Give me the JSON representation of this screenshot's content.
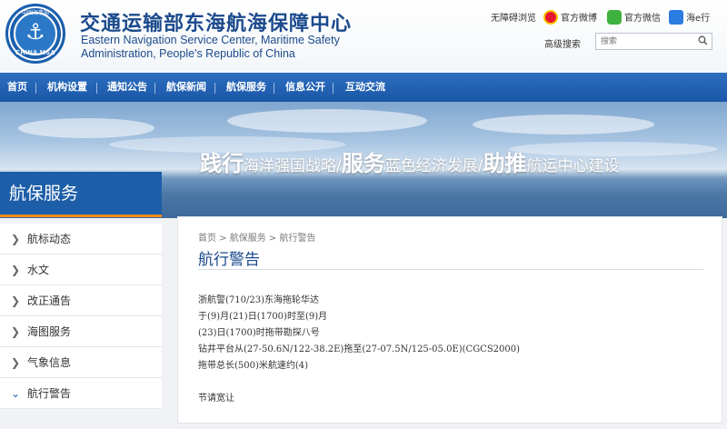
{
  "header": {
    "org_name_cn": "交通运输部东海航海保障中心",
    "org_name_en_line1": "Eastern Navigation Service Center, Maritime Safety",
    "org_name_en_line2": "Administration, People's Republic of China",
    "logo_text": "CHINA MSA",
    "logo_text_top": "中国海事局",
    "links": {
      "accessibility": "无障碍浏览",
      "weibo": "官方微博",
      "wechat": "官方微信",
      "app": "海e行",
      "advanced_search": "高级搜索"
    },
    "search": {
      "placeholder": "搜索"
    }
  },
  "nav": {
    "items": [
      "首页",
      "机构设置",
      "通知公告",
      "航保新闻",
      "航保服务",
      "信息公开",
      "互动交流"
    ]
  },
  "banner": {
    "part1_big": "践行",
    "part1": "海洋强国战略/",
    "part2_big": "服务",
    "part2": "蓝色经济发展/",
    "part3_big": "助推",
    "part3": "航运中心建设"
  },
  "sidebar": {
    "title": "航保服务",
    "items": [
      {
        "label": "航标动态",
        "active": false
      },
      {
        "label": "水文",
        "active": false
      },
      {
        "label": "改正通告",
        "active": false
      },
      {
        "label": "海图服务",
        "active": false
      },
      {
        "label": "气象信息",
        "active": false
      },
      {
        "label": "航行警告",
        "active": true
      }
    ]
  },
  "content": {
    "breadcrumb": "首页 > 航保服务 > 航行警告",
    "title": "航行警告",
    "lines": [
      "浙航警(710/23)东海拖轮华达",
      "于(9)月(21)日(1700)时至(9)月",
      "(23)日(1700)时拖带勘探八号",
      "钻井平台从(27-50.6N/122-38.2E)拖至(27-07.5N/125-05.0E)(CGCS2000)",
      "拖带总长(500)米航速约(4)",
      "",
      "节请宽让"
    ]
  },
  "colors": {
    "brand_blue": "#1d5ea8",
    "nav_blue": "#2d6fc1",
    "accent_orange": "#f08b1d"
  }
}
